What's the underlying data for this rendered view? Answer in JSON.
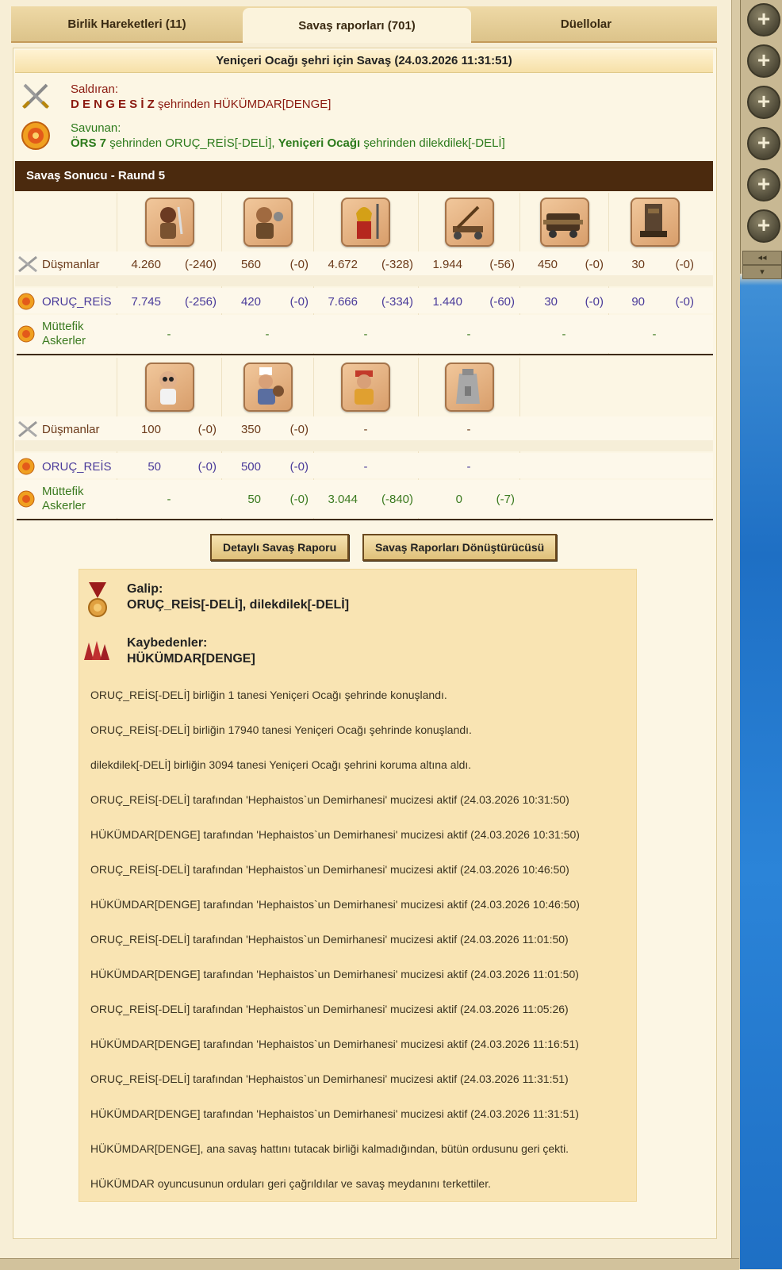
{
  "tabs": [
    {
      "label": "Birlik Hareketleri (11)"
    },
    {
      "label": "Savaş raporları (701)"
    },
    {
      "label": "Düellolar"
    }
  ],
  "battle": {
    "title": "Yeniçeri Ocağı şehri için Savaş (24.03.2026 11:31:51)",
    "attacker_label": "Saldıran:",
    "attacker_city": "D E N G E S İ Z",
    "attacker_from": "şehrinden HÜKÜMDAR[DENGE]",
    "defender_label": "Savunan:",
    "defender_city1": "ÖRS 7",
    "defender_from1": "şehrinden ORUÇ_REİS[-DELİ],",
    "defender_city2": "Yeniçeri Ocağı",
    "defender_from2": "şehrinden dilekdilek[-DELİ]"
  },
  "result_bar": "Savaş Sonucu - Raund 5",
  "table1": {
    "units": [
      "hoplite-unit",
      "slinger-unit",
      "spartan-unit",
      "catapult-unit",
      "ram-unit",
      "siege-tower-unit"
    ],
    "rows": [
      {
        "label": "Düşmanlar",
        "vals": [
          [
            "4.260",
            "(-240)"
          ],
          [
            "560",
            "(-0)"
          ],
          [
            "4.672",
            "(-328)"
          ],
          [
            "1.944",
            "(-56)"
          ],
          [
            "450",
            "(-0)"
          ],
          [
            "30",
            "(-0)"
          ]
        ]
      },
      {
        "label": "ORUÇ_REİS",
        "vals": [
          [
            "7.745",
            "(-256)"
          ],
          [
            "420",
            "(-0)"
          ],
          [
            "7.666",
            "(-334)"
          ],
          [
            "1.440",
            "(-60)"
          ],
          [
            "30",
            "(-0)"
          ],
          [
            "90",
            "(-0)"
          ]
        ]
      },
      {
        "label1": "Müttefik",
        "label2": "Askerler",
        "vals": [
          "-",
          "-",
          "-",
          "-",
          "-",
          "-"
        ]
      }
    ]
  },
  "table2": {
    "units": [
      "doctor-unit",
      "cook-unit",
      "merchant-unit",
      "wall-unit"
    ],
    "rows": [
      {
        "label": "Düşmanlar",
        "vals": [
          [
            "100",
            "(-0)"
          ],
          [
            "350",
            "(-0)"
          ],
          "-",
          "-"
        ]
      },
      {
        "label": "ORUÇ_REİS",
        "vals": [
          [
            "50",
            "(-0)"
          ],
          [
            "500",
            "(-0)"
          ],
          "-",
          "-"
        ]
      },
      {
        "label1": "Müttefik",
        "label2": "Askerler",
        "vals": [
          "-",
          [
            "50",
            "(-0)"
          ],
          [
            "3.044",
            "(-840)"
          ],
          [
            "0",
            "(-7)"
          ]
        ]
      }
    ]
  },
  "buttons": {
    "detail": "Detaylı Savaş Raporu",
    "converter": "Savaş Raporları Dönüştürücüsü"
  },
  "summary": {
    "winner_label": "Galip:",
    "winner_names": "ORUÇ_REİS[-DELİ], dilekdilek[-DELİ]",
    "loser_label": "Kaybedenler:",
    "loser_names": "HÜKÜMDAR[DENGE]",
    "log": [
      "ORUÇ_REİS[-DELİ] birliğin 1 tanesi Yeniçeri Ocağı şehrinde konuşlandı.",
      "ORUÇ_REİS[-DELİ] birliğin 17940 tanesi Yeniçeri Ocağı şehrinde konuşlandı.",
      "dilekdilek[-DELİ] birliğin 3094 tanesi Yeniçeri Ocağı şehrini koruma altına aldı.",
      "ORUÇ_REİS[-DELİ] tarafından 'Hephaistos`un Demirhanesi' mucizesi aktif (24.03.2026 10:31:50)",
      "HÜKÜMDAR[DENGE] tarafından 'Hephaistos`un Demirhanesi' mucizesi aktif (24.03.2026 10:31:50)",
      "ORUÇ_REİS[-DELİ] tarafından 'Hephaistos`un Demirhanesi' mucizesi aktif (24.03.2026 10:46:50)",
      "HÜKÜMDAR[DENGE] tarafından 'Hephaistos`un Demirhanesi' mucizesi aktif (24.03.2026 10:46:50)",
      "ORUÇ_REİS[-DELİ] tarafından 'Hephaistos`un Demirhanesi' mucizesi aktif (24.03.2026 11:01:50)",
      "HÜKÜMDAR[DENGE] tarafından 'Hephaistos`un Demirhanesi' mucizesi aktif (24.03.2026 11:01:50)",
      "ORUÇ_REİS[-DELİ] tarafından 'Hephaistos`un Demirhanesi' mucizesi aktif (24.03.2026 11:05:26)",
      "HÜKÜMDAR[DENGE] tarafından 'Hephaistos`un Demirhanesi' mucizesi aktif (24.03.2026 11:16:51)",
      "ORUÇ_REİS[-DELİ] tarafından 'Hephaistos`un Demirhanesi' mucizesi aktif (24.03.2026 11:31:51)",
      "HÜKÜMDAR[DENGE] tarafından 'Hephaistos`un Demirhanesi' mucizesi aktif (24.03.2026 11:31:51)",
      "HÜKÜMDAR[DENGE], ana savaş hattını tutacak birliği kalmadığından, bütün ordusunu geri çekti.",
      "HÜKÜMDAR oyuncusunun orduları geri çağrıldılar ve savaş meydanını terkettiler."
    ]
  },
  "sidebar": {
    "plus_icons": [
      "plus-icon",
      "plus-icon",
      "plus-icon",
      "plus-icon",
      "plus-icon",
      "plus-icon"
    ],
    "collapse_symbol": "◂◂",
    "expand_symbol": "▾"
  }
}
